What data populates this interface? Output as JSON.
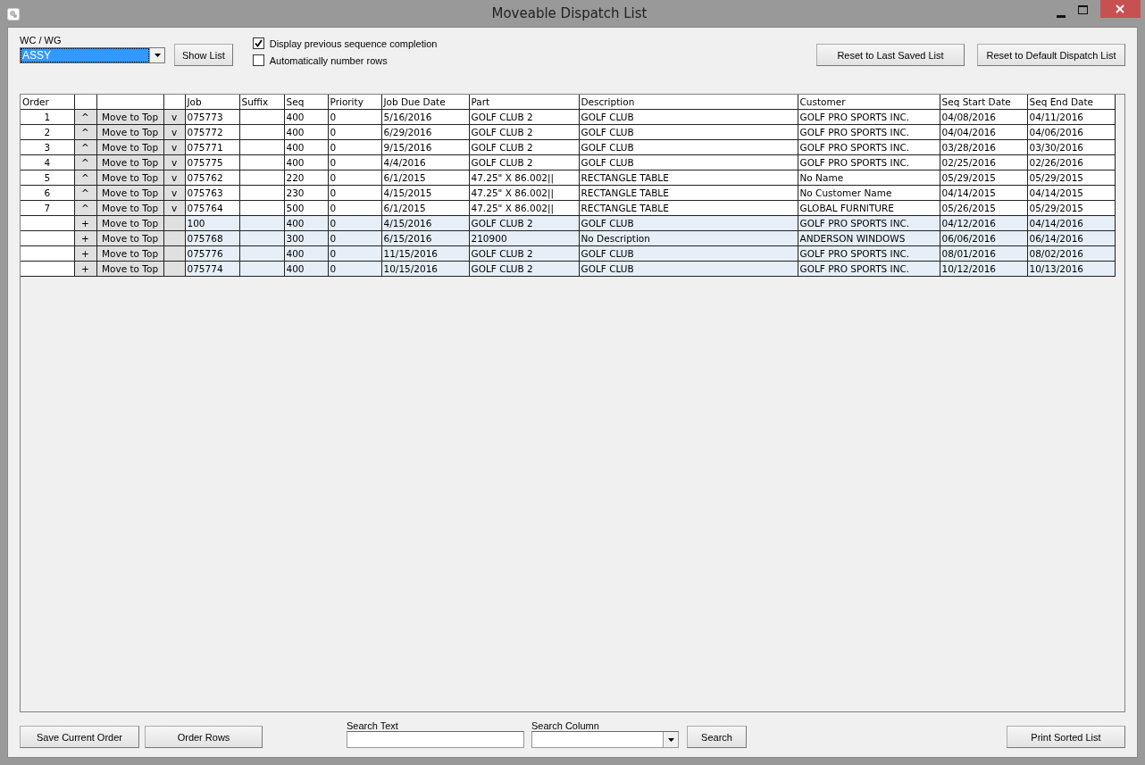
{
  "window": {
    "title": "Moveable Dispatch List"
  },
  "filters": {
    "wc_label": "WC / WG",
    "wc_value": "ASSY",
    "show_list": "Show List",
    "options": [
      {
        "label": "Display previous sequence completion",
        "checked": true
      },
      {
        "label": "Automatically number rows",
        "checked": false
      }
    ],
    "reset_buttons": [
      "Reset to Last Saved List",
      "Reset to Default Dispatch List"
    ]
  },
  "table": {
    "order_column": "Order",
    "columns": [
      "Job",
      "Suffix",
      "Seq",
      "Priority",
      "Job Due Date",
      "Part",
      "Description",
      "Customer",
      "Seq Start Date",
      "Seq End Date"
    ],
    "rows": [
      {
        "kind": "ordered",
        "order": "1",
        "up": "^",
        "move": "Move to Top",
        "down": "v",
        "cells": [
          "075773",
          "",
          "400",
          "0",
          "5/16/2016",
          "GOLF CLUB 2",
          "GOLF CLUB",
          "GOLF PRO SPORTS INC.",
          "04/08/2016",
          "04/11/2016"
        ]
      },
      {
        "kind": "ordered",
        "order": "2",
        "up": "^",
        "move": "Move to Top",
        "down": "v",
        "cells": [
          "075772",
          "",
          "400",
          "0",
          "6/29/2016",
          "GOLF CLUB 2",
          "GOLF CLUB",
          "GOLF PRO SPORTS INC.",
          "04/04/2016",
          "04/06/2016"
        ]
      },
      {
        "kind": "ordered",
        "order": "3",
        "up": "^",
        "move": "Move to Top",
        "down": "v",
        "cells": [
          "075771",
          "",
          "400",
          "0",
          "9/15/2016",
          "GOLF CLUB 2",
          "GOLF CLUB",
          "GOLF PRO SPORTS INC.",
          "03/28/2016",
          "03/30/2016"
        ]
      },
      {
        "kind": "ordered",
        "order": "4",
        "up": "^",
        "move": "Move to Top",
        "down": "v",
        "cells": [
          "075775",
          "",
          "400",
          "0",
          "4/4/2016",
          "GOLF CLUB 2",
          "GOLF CLUB",
          "GOLF PRO SPORTS INC.",
          "02/25/2016",
          "02/26/2016"
        ]
      },
      {
        "kind": "ordered",
        "order": "5",
        "up": "^",
        "move": "Move to Top",
        "down": "v",
        "cells": [
          "075762",
          "",
          "220",
          "0",
          "6/1/2015",
          "47.25\" X 86.002||",
          "RECTANGLE TABLE",
          "No Name",
          "05/29/2015",
          "05/29/2015"
        ]
      },
      {
        "kind": "ordered",
        "order": "6",
        "up": "^",
        "move": "Move to Top",
        "down": "v",
        "cells": [
          "075763",
          "",
          "230",
          "0",
          "4/15/2015",
          "47.25\" X 86.002||",
          "RECTANGLE TABLE",
          "No Customer Name",
          "04/14/2015",
          "04/14/2015"
        ]
      },
      {
        "kind": "ordered",
        "order": "7",
        "up": "^",
        "move": "Move to Top",
        "down": "v",
        "cells": [
          "075764",
          "",
          "500",
          "0",
          "6/1/2015",
          "47.25\" X 86.002||",
          "RECTANGLE TABLE",
          "GLOBAL FURNITURE",
          "05/26/2015",
          "05/29/2015"
        ]
      },
      {
        "kind": "new",
        "up": "+",
        "move": "Move to Top",
        "cells": [
          "100",
          "",
          "400",
          "0",
          "4/15/2016",
          "GOLF CLUB 2",
          "GOLF CLUB",
          "GOLF PRO SPORTS INC.",
          "04/12/2016",
          "04/14/2016"
        ]
      },
      {
        "kind": "new",
        "up": "+",
        "move": "Move to Top",
        "cells": [
          "075768",
          "",
          "300",
          "0",
          "6/15/2016",
          "210900",
          "No Description",
          "ANDERSON WINDOWS",
          "06/06/2016",
          "06/14/2016"
        ]
      },
      {
        "kind": "new",
        "up": "+",
        "move": "Move to Top",
        "cells": [
          "075776",
          "",
          "400",
          "0",
          "11/15/2016",
          "GOLF CLUB 2",
          "GOLF CLUB",
          "GOLF PRO SPORTS INC.",
          "08/01/2016",
          "08/02/2016"
        ]
      },
      {
        "kind": "new",
        "up": "+",
        "move": "Move to Top",
        "cells": [
          "075774",
          "",
          "400",
          "0",
          "10/15/2016",
          "GOLF CLUB 2",
          "GOLF CLUB",
          "GOLF PRO SPORTS INC.",
          "10/12/2016",
          "10/13/2016"
        ]
      }
    ]
  },
  "footer": {
    "save": "Save Current Order",
    "order_rows": "Order Rows",
    "search_text_label": "Search Text",
    "search_column_label": "Search Column",
    "search": "Search",
    "print": "Print Sorted List"
  }
}
